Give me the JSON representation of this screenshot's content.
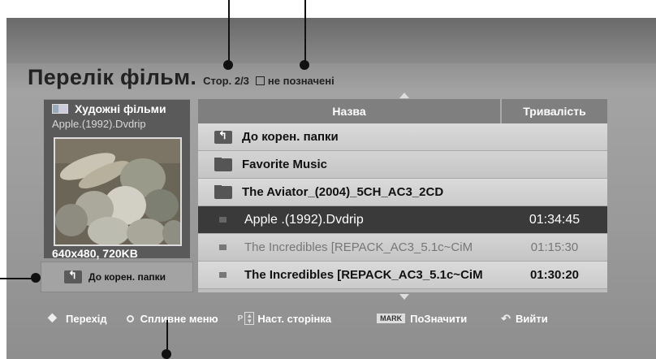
{
  "title": "Перелік фільм.",
  "page_info": "Стор. 2/3",
  "checkbox_glyph": "☑",
  "unmarked_label": "не позначені",
  "preview": {
    "category": "Художні фільми",
    "filename": "Apple.(1992).Dvdrip",
    "resolution": "640x480, 720KB"
  },
  "side_button_label": "До корен. папки",
  "list": {
    "header_name": "Назва",
    "header_duration": "Тривалість",
    "rows": [
      {
        "name": "До корен. папки",
        "duration": "",
        "type": "back"
      },
      {
        "name": "Favorite Music",
        "duration": "",
        "type": "folder"
      },
      {
        "name": "The Aviator_(2004)_5CH_AC3_2CD",
        "duration": "",
        "type": "folder"
      },
      {
        "name": "Apple .(1992).Dvdrip",
        "duration": "01:34:45",
        "type": "file",
        "selected": true
      },
      {
        "name": "The Incredibles [REPACK_AC3_5.1c~CiM",
        "duration": "01:15:30",
        "type": "file",
        "dim": true
      },
      {
        "name": "The Incredibles [REPACK_AC3_5.1c~CiM",
        "duration": "01:30:20",
        "type": "file"
      }
    ]
  },
  "footer": {
    "navigate": "Перехід",
    "popup_menu": "Спливне меню",
    "page_key": "P",
    "page_nav": "Наст. сторінка",
    "mark_key": "MARK",
    "mark": "ПоЗначити",
    "exit": "Вийти"
  }
}
